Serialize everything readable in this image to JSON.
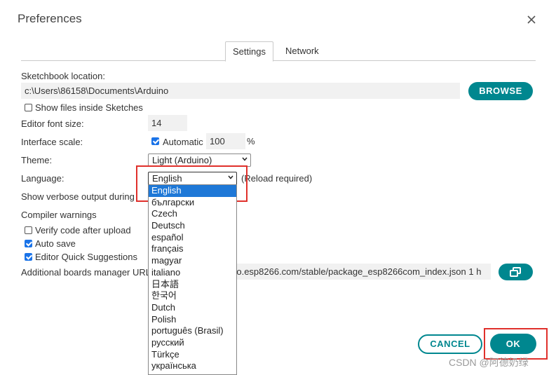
{
  "dialog": {
    "title": "Preferences"
  },
  "tabs": [
    {
      "label": "Settings",
      "active": true
    },
    {
      "label": "Network",
      "active": false
    }
  ],
  "sketchbook": {
    "label": "Sketchbook location:",
    "path": "c:\\Users\\86158\\Documents\\Arduino",
    "browse_label": "BROWSE"
  },
  "show_files": {
    "label": "Show files inside Sketches",
    "checked": false
  },
  "font_size": {
    "label": "Editor font size:",
    "value": "14"
  },
  "interface_scale": {
    "label": "Interface scale:",
    "automatic_label": "Automatic",
    "automatic_checked": true,
    "value": "100",
    "unit": "%"
  },
  "theme": {
    "label": "Theme:",
    "value": "Light (Arduino)"
  },
  "language": {
    "label": "Language:",
    "value": "English",
    "note": "(Reload required)",
    "options": [
      "English",
      "български",
      "Czech",
      "Deutsch",
      "español",
      "français",
      "magyar",
      "italiano",
      "日本語",
      "한국어",
      "Dutch",
      "Polish",
      "português (Brasil)",
      "русский",
      "Türkçe",
      "українська"
    ]
  },
  "verbose": {
    "label": "Show verbose output during"
  },
  "compiler_warnings": {
    "label": "Compiler warnings"
  },
  "verify_upload": {
    "label": "Verify code after upload",
    "checked": false
  },
  "auto_save": {
    "label": "Auto save",
    "checked": true
  },
  "quick_suggestions": {
    "label": "Editor Quick Suggestions",
    "checked": true
  },
  "boards_url": {
    "label": "Additional boards manager URL",
    "value": "uino.esp8266.com/stable/package_esp8266com_index.json 1 h"
  },
  "footer": {
    "cancel_label": "CANCEL",
    "ok_label": "OK"
  },
  "watermark": "CSDN @阿德奶绿",
  "colors": {
    "accent": "#00878f",
    "highlight": "#e0302b",
    "selection": "#1e78d7"
  }
}
